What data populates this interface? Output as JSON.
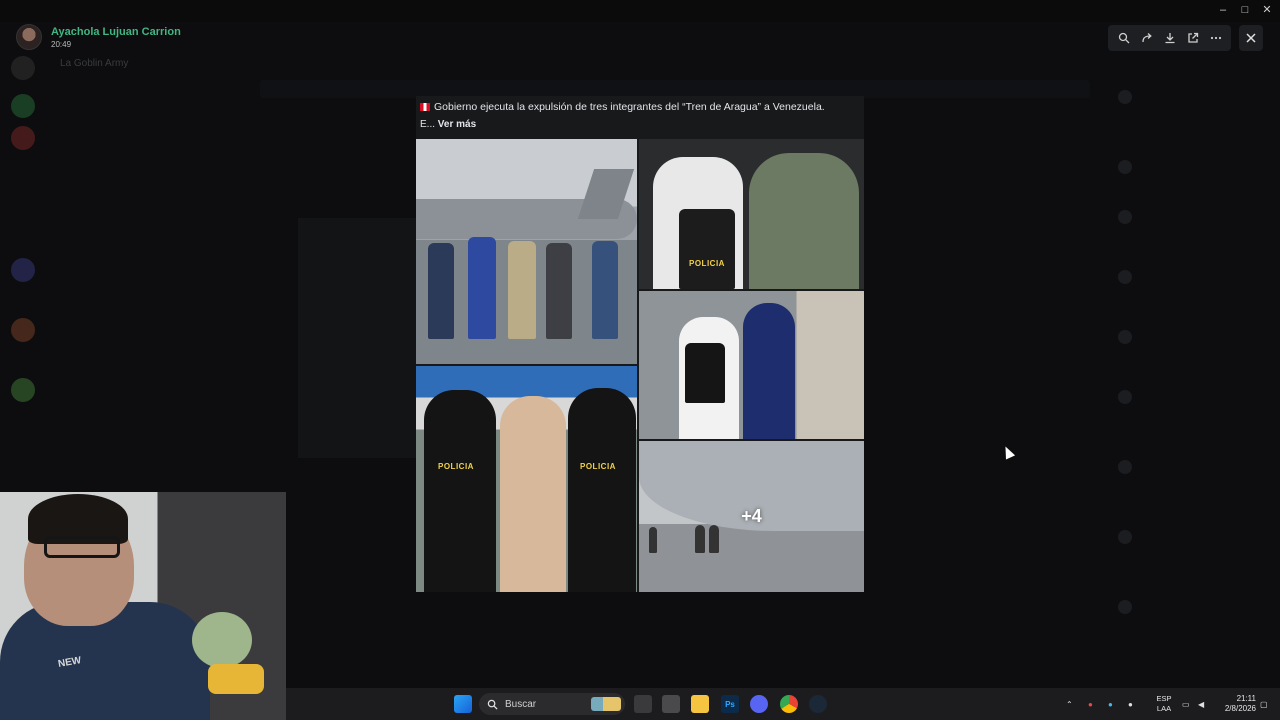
{
  "window": {
    "title": "La Goblin Army",
    "controls": [
      "minimize",
      "maximize",
      "close"
    ]
  },
  "viewer": {
    "author": {
      "name": "Ayachola Lujuan Carrion",
      "time": "20:49"
    },
    "tools": [
      {
        "name": "zoom-icon"
      },
      {
        "name": "forward-icon"
      },
      {
        "name": "download-icon"
      },
      {
        "name": "open-external-icon"
      },
      {
        "name": "more-icon"
      }
    ]
  },
  "post": {
    "caption": "Gobierno ejecuta la expulsión de tres integrantes del “Tren de Aragua” a Venezuela.",
    "caption_prefix": "E...",
    "see_more": "Ver más",
    "more_photos": "+4",
    "police_text": "POLICIA"
  },
  "taskbar": {
    "search_placeholder": "Buscar",
    "apps": [
      "start",
      "search",
      "task-view",
      "file-explorer",
      "photoshop",
      "discord",
      "chrome",
      "steam"
    ],
    "language_line1": "ESP",
    "language_line2": "LAA",
    "time": "21:11",
    "date": "2/8/2026"
  },
  "colors": {
    "author_name": "#43b581",
    "viewer_bg": "#0a0a0b",
    "toolbar_bg": "#1e1f22"
  },
  "webcam": {
    "shirt_text": "NEW"
  }
}
